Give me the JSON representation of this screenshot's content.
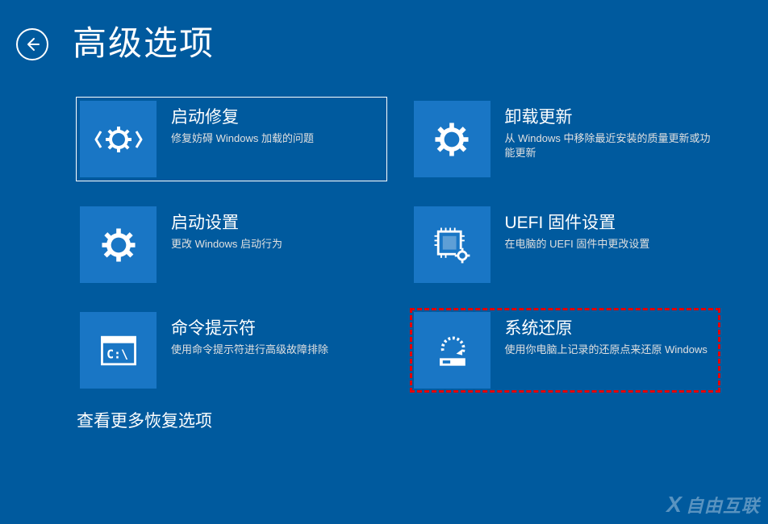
{
  "title": "高级选项",
  "tiles": [
    {
      "title": "启动修复",
      "desc": "修复妨碍 Windows 加载的问题"
    },
    {
      "title": "卸载更新",
      "desc": "从 Windows 中移除最近安装的质量更新或功能更新"
    },
    {
      "title": "启动设置",
      "desc": "更改 Windows 启动行为"
    },
    {
      "title": "UEFI 固件设置",
      "desc": "在电脑的 UEFI 固件中更改设置"
    },
    {
      "title": "命令提示符",
      "desc": "使用命令提示符进行高级故障排除"
    },
    {
      "title": "系统还原",
      "desc": "使用你电脑上记录的还原点来还原 Windows"
    }
  ],
  "more": "查看更多恢复选项",
  "watermark": "自由互联"
}
